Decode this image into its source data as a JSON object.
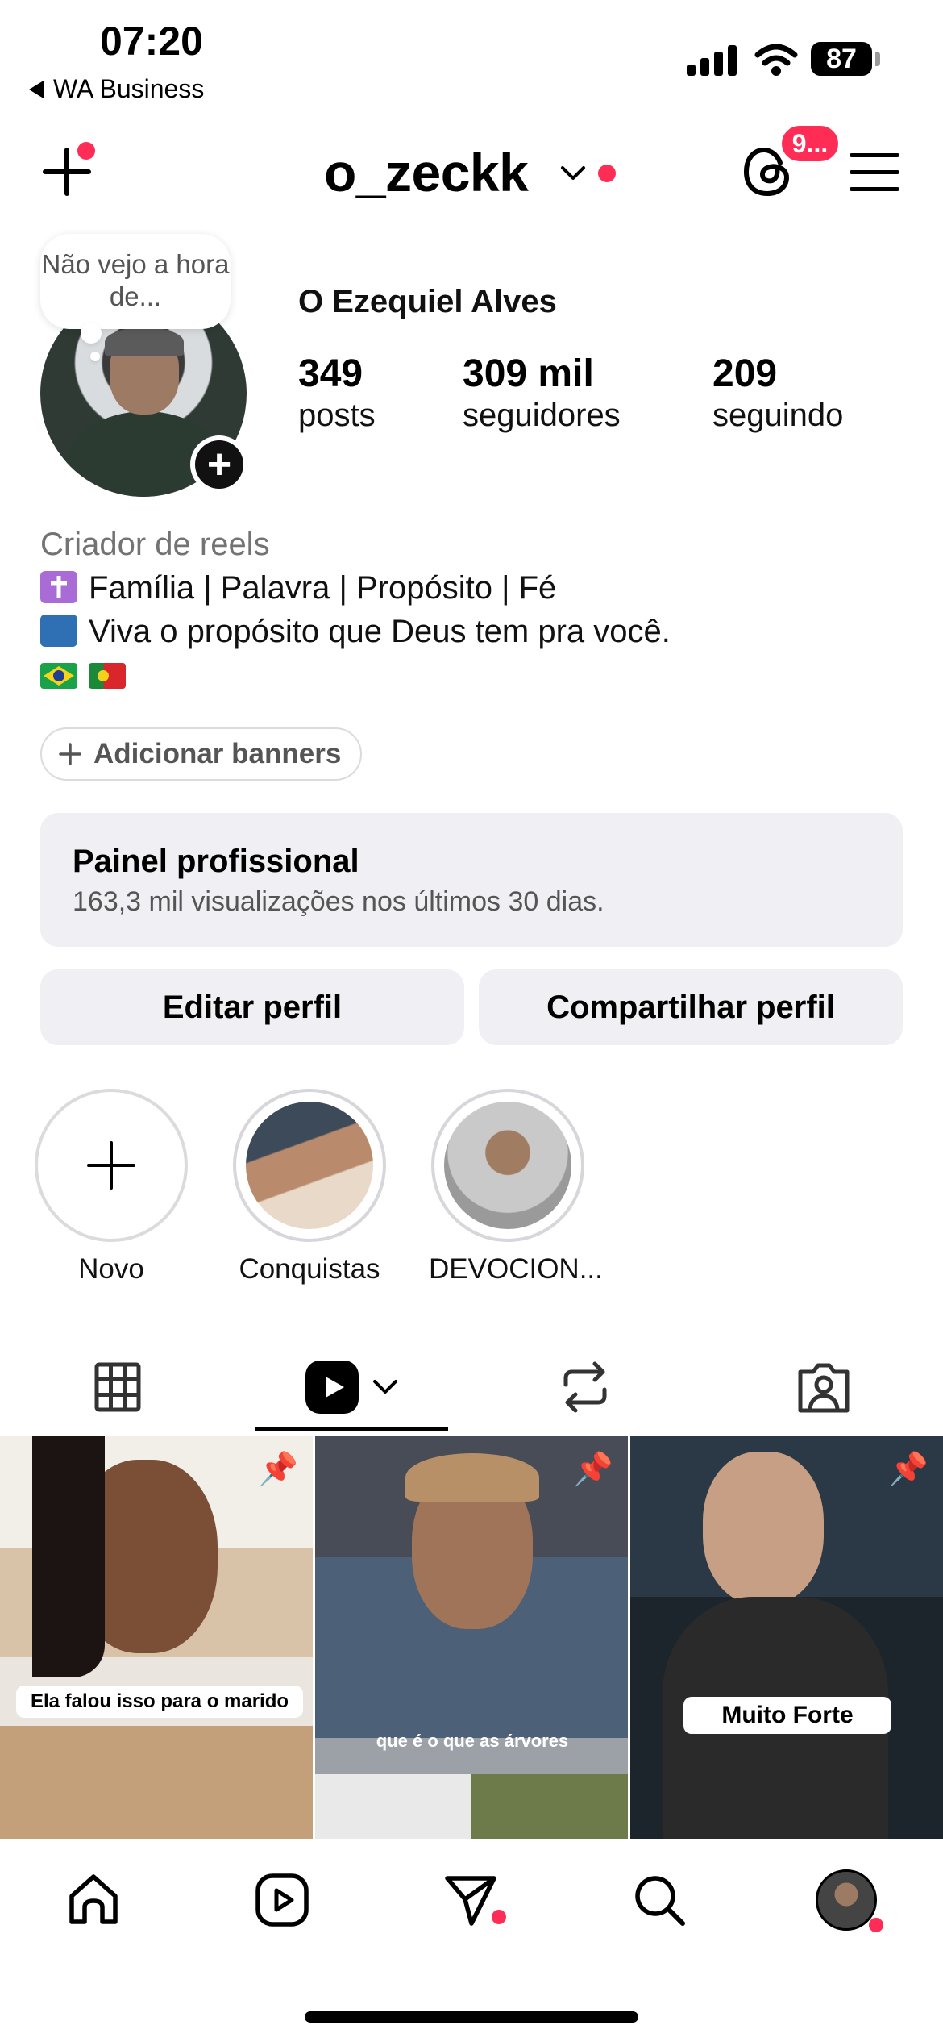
{
  "status_bar": {
    "time": "07:20",
    "back_app": "WA Business",
    "battery": "87"
  },
  "header": {
    "username": "o_zeckk",
    "notifications_badge": "9..."
  },
  "profile": {
    "note": "Não vejo a hora de...",
    "full_name": "O Ezequiel Alves",
    "stats": [
      {
        "value": "349",
        "label": "posts"
      },
      {
        "value": "309 mil",
        "label": "seguidores"
      },
      {
        "value": "209",
        "label": "seguindo"
      }
    ],
    "bio": {
      "category": "Criador de reels",
      "line1": "Família | Palavra | Propósito | Fé",
      "line2": "Viva o propósito que Deus tem pra você."
    }
  },
  "banners_button": "Adicionar banners",
  "pro_panel": {
    "title": "Painel profissional",
    "subtitle": "163,3 mil visualizações nos últimos 30 dias."
  },
  "actions": {
    "edit": "Editar perfil",
    "share": "Compartilhar perfil"
  },
  "highlights": [
    {
      "label": "Novo"
    },
    {
      "label": "Conquistas"
    },
    {
      "label": "DEVOCION..."
    }
  ],
  "grid": [
    {
      "caption": "Ela falou isso para o marido",
      "pinned": true
    },
    {
      "caption": "que é o que as árvores",
      "pinned": true
    },
    {
      "caption": "Muito Forte",
      "pinned": true
    }
  ],
  "colors": {
    "accent_red": "#ff2d55",
    "button_bg": "#efeff4",
    "muted_text": "#737373"
  }
}
